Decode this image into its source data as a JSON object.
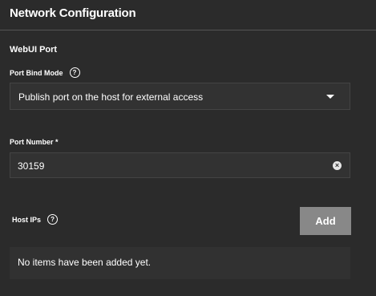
{
  "panel": {
    "title": "Network Configuration"
  },
  "webui_port": {
    "section_title": "WebUI Port",
    "bind_mode": {
      "label": "Port Bind Mode",
      "help_icon": "help-circle-icon",
      "value": "Publish port on the host for external access",
      "dropdown_icon": "caret-down-icon"
    },
    "port_number": {
      "label": "Port Number *",
      "value": "30159",
      "clear_icon": "clear-circle-icon"
    },
    "host_ips": {
      "label": "Host IPs",
      "help_icon": "help-circle-icon",
      "add_label": "Add",
      "empty_message": "No items have been added yet."
    }
  },
  "colors": {
    "background": "#2b2b2b",
    "field_background": "#323232",
    "button_disabled": "#888888",
    "text": "#ffffff"
  }
}
